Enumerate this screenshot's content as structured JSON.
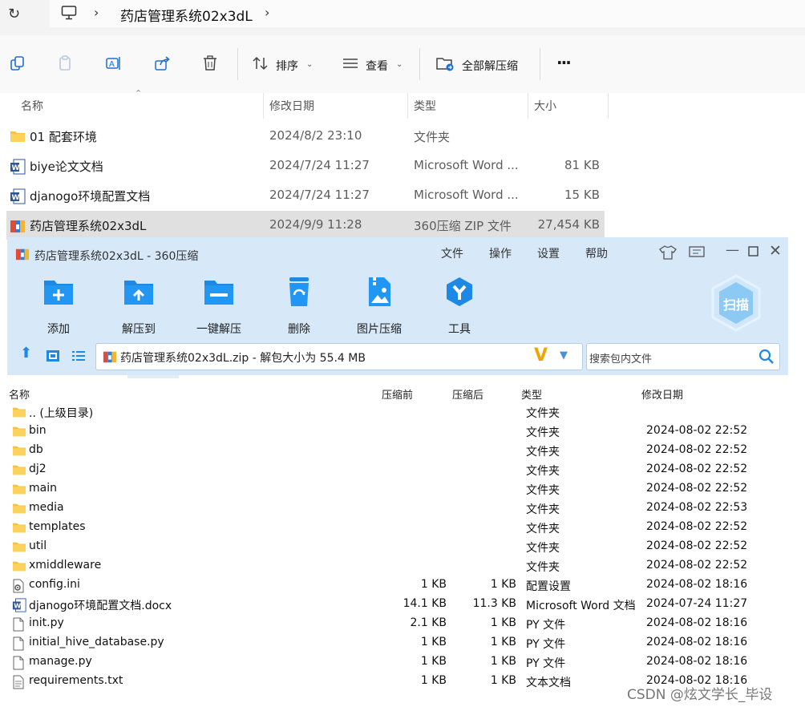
{
  "explorer": {
    "breadcrumb": "药店管理系统02x3dL",
    "toolbar": {
      "sort_label": "排序",
      "view_label": "查看",
      "extract_all_label": "全部解压缩",
      "more_label": "···"
    },
    "columns": {
      "name": "名称",
      "date": "修改日期",
      "type": "类型",
      "size": "大小"
    },
    "files": [
      {
        "name": "01 配套环境",
        "date": "2024/8/2 23:10",
        "type": "文件夹",
        "size": "",
        "icon": "folder-icon"
      },
      {
        "name": "biye论文文档",
        "date": "2024/7/24 11:27",
        "type": "Microsoft Word ...",
        "size": "81 KB",
        "icon": "word-doc-icon"
      },
      {
        "name": "djanogo环境配置文档",
        "date": "2024/7/24 11:27",
        "type": "Microsoft Word ...",
        "size": "15 KB",
        "icon": "word-doc-icon"
      },
      {
        "name": "药店管理系统02x3dL",
        "date": "2024/9/9 11:28",
        "type": "360压缩 ZIP 文件",
        "size": "27,454 KB",
        "icon": "zip-archive-icon"
      }
    ]
  },
  "archive_window": {
    "title": "药店管理系统02x3dL - 360压缩",
    "menu": [
      "文件",
      "操作",
      "设置",
      "帮助"
    ],
    "tools": [
      "添加",
      "解压到",
      "一键解压",
      "删除",
      "图片压缩",
      "工具"
    ],
    "scan_label": "扫描",
    "path": "药店管理系统02x3dL.zip - 解包大小为 55.4 MB",
    "search_placeholder": "搜索包内文件",
    "columns": {
      "name": "名称",
      "before": "压缩前",
      "after": "压缩后",
      "type": "类型",
      "date": "修改日期"
    },
    "rows": [
      {
        "name": ".. (上级目录)",
        "before": "",
        "after": "",
        "type": "文件夹",
        "date": "",
        "icon": "folder-icon"
      },
      {
        "name": "bin",
        "before": "",
        "after": "",
        "type": "文件夹",
        "date": "2024-08-02 22:52",
        "icon": "folder-icon"
      },
      {
        "name": "db",
        "before": "",
        "after": "",
        "type": "文件夹",
        "date": "2024-08-02 22:52",
        "icon": "folder-icon"
      },
      {
        "name": "dj2",
        "before": "",
        "after": "",
        "type": "文件夹",
        "date": "2024-08-02 22:52",
        "icon": "folder-icon"
      },
      {
        "name": "main",
        "before": "",
        "after": "",
        "type": "文件夹",
        "date": "2024-08-02 22:52",
        "icon": "folder-icon"
      },
      {
        "name": "media",
        "before": "",
        "after": "",
        "type": "文件夹",
        "date": "2024-08-02 22:53",
        "icon": "folder-icon"
      },
      {
        "name": "templates",
        "before": "",
        "after": "",
        "type": "文件夹",
        "date": "2024-08-02 22:52",
        "icon": "folder-icon"
      },
      {
        "name": "util",
        "before": "",
        "after": "",
        "type": "文件夹",
        "date": "2024-08-02 22:52",
        "icon": "folder-icon"
      },
      {
        "name": "xmiddleware",
        "before": "",
        "after": "",
        "type": "文件夹",
        "date": "2024-08-02 22:52",
        "icon": "folder-icon"
      },
      {
        "name": "config.ini",
        "before": "1 KB",
        "after": "1 KB",
        "type": "配置设置",
        "date": "2024-08-02 18:16",
        "icon": "config-file-icon"
      },
      {
        "name": "djanogo环境配置文档.docx",
        "before": "14.1 KB",
        "after": "11.3 KB",
        "type": "Microsoft Word 文档",
        "date": "2024-07-24 11:27",
        "icon": "word-doc-icon"
      },
      {
        "name": "init.py",
        "before": "2.1 KB",
        "after": "1 KB",
        "type": "PY 文件",
        "date": "2024-08-02 18:16",
        "icon": "file-icon"
      },
      {
        "name": "initial_hive_database.py",
        "before": "1 KB",
        "after": "1 KB",
        "type": "PY 文件",
        "date": "2024-08-02 18:16",
        "icon": "file-icon"
      },
      {
        "name": "manage.py",
        "before": "1 KB",
        "after": "1 KB",
        "type": "PY 文件",
        "date": "2024-08-02 18:16",
        "icon": "file-icon"
      },
      {
        "name": "requirements.txt",
        "before": "1 KB",
        "after": "1 KB",
        "type": "文本文档",
        "date": "2024-08-02 18:16",
        "icon": "text-file-icon"
      }
    ]
  },
  "watermark": "CSDN @炫文学长_毕设",
  "colors": {
    "accent_blue": "#1e88e5",
    "window_bg": "#d7e8f8",
    "folder_yellow": "#f6c445",
    "selection": "#e0e0e0"
  }
}
